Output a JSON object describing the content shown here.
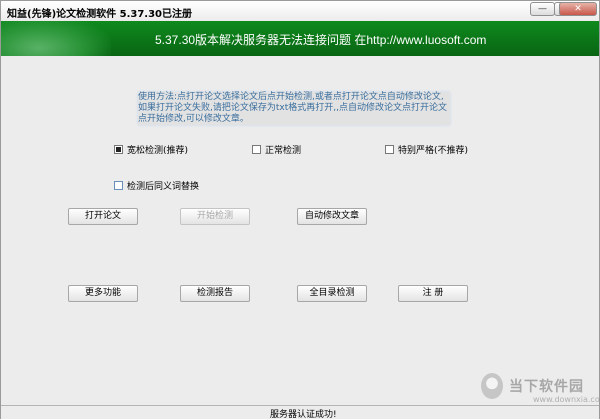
{
  "window": {
    "title": "知益(先锋)论文检测软件 5.37.30已注册",
    "min_icon": "minimize-icon",
    "max_icon": "maximize-icon",
    "close_icon": "close-icon"
  },
  "banner": {
    "text": "5.37.30版本解决服务器无法连接问题 在http://www.luosoft.com"
  },
  "instructions": "使用方法:点打开论文选择论文后点开始检测,或者点打开论文点自动修改论文,如果打开论文失败,请把论文保存为txt格式再打开,,点自动修改论文点打开论文点开始修改,可以修改文章。",
  "modes": [
    {
      "label": "宽松检测(推荐)",
      "checked": true
    },
    {
      "label": "正常检测",
      "checked": false
    },
    {
      "label": "特别严格(不推荐)",
      "checked": false
    }
  ],
  "option": {
    "label": "检测后同义词替换",
    "checked": false
  },
  "buttons": {
    "open": "打开论文",
    "start": "开始检测",
    "auto_modify": "自动修改文章",
    "more": "更多功能",
    "report": "检测报告",
    "full_dir": "全目录检测",
    "register": "注 册"
  },
  "status": "服务器认证成功!",
  "watermark": {
    "cn": "当下软件园",
    "en": "www.downxia.com"
  },
  "colors": {
    "banner": "#0b7a18",
    "instructions": "#3a6e9e",
    "disabled": "#a8a8a8"
  }
}
